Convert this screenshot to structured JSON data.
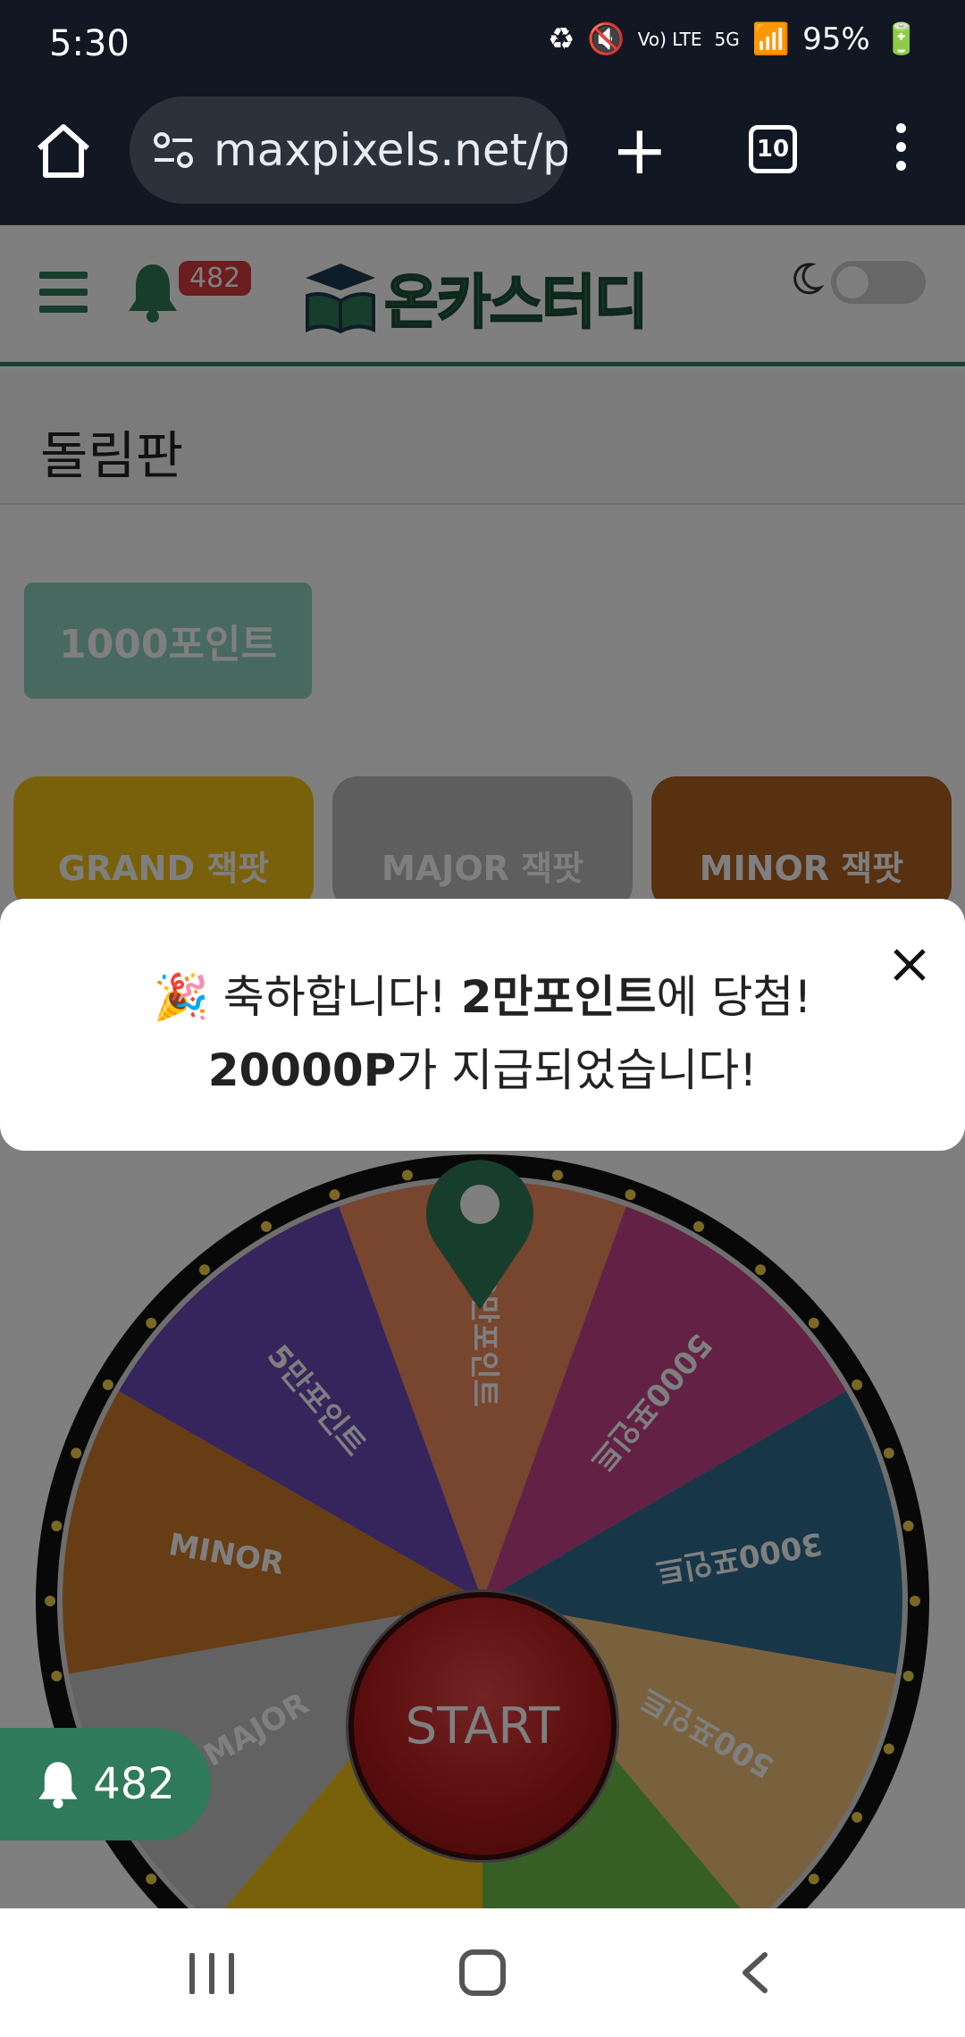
{
  "status_bar": {
    "time": "5:30",
    "volte": "Vo) LTE",
    "network": "5G",
    "battery": "95%"
  },
  "browser": {
    "url": "maxpixels.net/p",
    "tab_count": "10"
  },
  "header": {
    "notification_count": "482",
    "logo_text": "온카스터디",
    "dark_mode_on": false
  },
  "page": {
    "title": "돌림판",
    "points_button": "1000포인트",
    "jackpots": [
      "GRAND 잭팟",
      "MAJOR 잭팟",
      "MINOR 잭팟"
    ]
  },
  "wheel": {
    "segments": [
      {
        "label": "2만포인트",
        "color": "#f08a5d"
      },
      {
        "label": "5000포인트",
        "color": "#c6438b"
      },
      {
        "label": "3000포인트",
        "color": "#2f6f91"
      },
      {
        "label": "500포인트",
        "color": "#f4c27a"
      },
      {
        "label": "",
        "color": "#6fbf4a"
      },
      {
        "label": "",
        "color": "#f2c318"
      },
      {
        "label": "MAJOR",
        "color": "#c4c4c4"
      },
      {
        "label": "MINOR",
        "color": "#cf7b2c"
      },
      {
        "label": "5만포인트",
        "color": "#6a4bb8"
      }
    ],
    "start_label": "START",
    "pointer_color": "#2e7a5a"
  },
  "toast": {
    "emoji": "🎉",
    "line1_pre": "축하합니다!",
    "line1_bold": "2만포인트",
    "line1_post": "에 당첨!",
    "line2_bold": "20000P",
    "line2_post": "가 지급되었습니다!"
  },
  "float_bell": {
    "count": "482"
  }
}
